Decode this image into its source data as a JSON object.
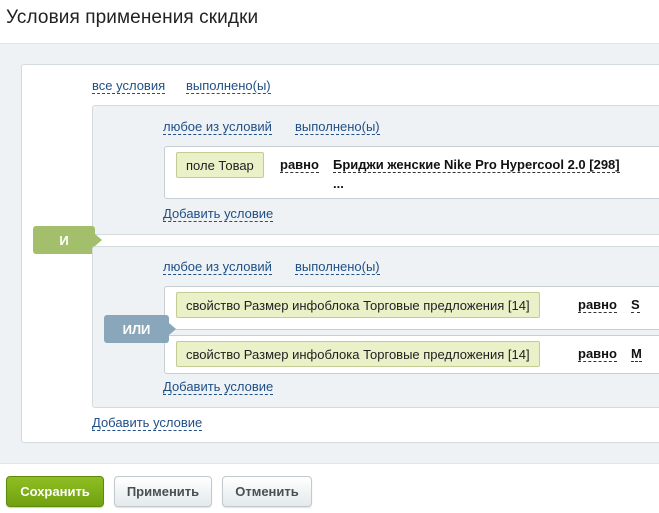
{
  "title": "Условия применения скидки",
  "root": {
    "mode": "все условия",
    "state": "выполнено(ы)",
    "logic_label": "И",
    "add_condition": "Добавить условие"
  },
  "group1": {
    "mode": "любое из условий",
    "state": "выполнено(ы)",
    "condition": {
      "field": "поле Товар",
      "operator": "равно",
      "value_line1": "Бриджи женские Nike Pro Hypercool 2.0 [298]",
      "value_line2": "..."
    },
    "add_condition": "Добавить условие"
  },
  "group2": {
    "mode": "любое из условий",
    "state": "выполнено(ы)",
    "logic_label": "ИЛИ",
    "conditions": [
      {
        "field": "свойство Размер инфоблока Торговые предложения [14]",
        "operator": "равно",
        "value": "S"
      },
      {
        "field": "свойство Размер инфоблока Торговые предложения [14]",
        "operator": "равно",
        "value": "M"
      }
    ],
    "add_condition": "Добавить условие"
  },
  "buttons": {
    "save": "Сохранить",
    "apply": "Применить",
    "cancel": "Отменить"
  },
  "colors": {
    "and_badge": "#a4bf6b",
    "or_badge": "#8aa6bb",
    "save_button": "#7aad17",
    "link": "#1f4f86"
  }
}
